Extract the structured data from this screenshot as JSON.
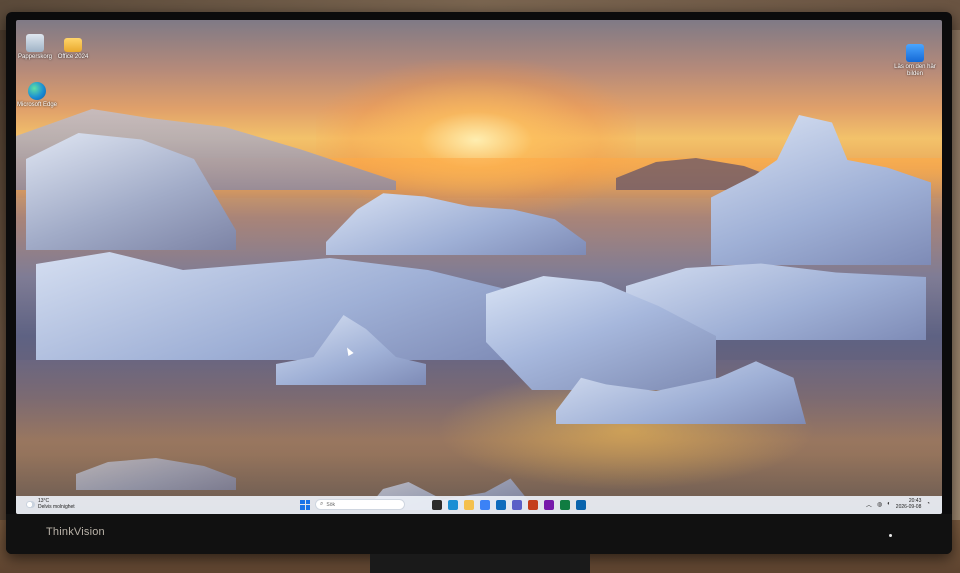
{
  "monitor": {
    "brand": "ThinkVision"
  },
  "desktop": {
    "icons": [
      {
        "name": "recycle-bin",
        "label": "Papperskorg"
      },
      {
        "name": "folder",
        "label": "Office 2024"
      },
      {
        "name": "edge",
        "label": "Microsoft Edge"
      },
      {
        "name": "spotlight",
        "label": "Läs om den här bilden"
      }
    ]
  },
  "taskbar": {
    "weather": {
      "temp": "13°C",
      "condition": "Delvis molnighet"
    },
    "search": {
      "placeholder": "Sök"
    },
    "apps": [
      {
        "name": "task-view",
        "color": "#2b2b2b"
      },
      {
        "name": "edge",
        "color": "#1b8fd4"
      },
      {
        "name": "file-explorer",
        "color": "#f4c04e"
      },
      {
        "name": "store",
        "color": "#3b82f6"
      },
      {
        "name": "mail",
        "color": "#0f6cbd"
      },
      {
        "name": "teams",
        "color": "#5b5fc7"
      },
      {
        "name": "powerpoint",
        "color": "#c43e1c"
      },
      {
        "name": "onenote",
        "color": "#7719aa"
      },
      {
        "name": "excel",
        "color": "#107c41"
      },
      {
        "name": "outlook",
        "color": "#0a64ad"
      }
    ],
    "clock": {
      "time": "20:43",
      "date": "2026-09-08"
    }
  }
}
